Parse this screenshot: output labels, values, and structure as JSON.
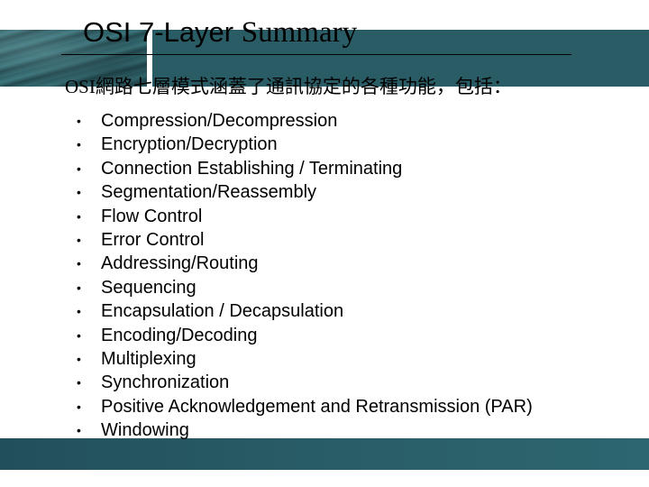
{
  "slide": {
    "title_sans": "OSI 7-Layer",
    "title_serif": "Summary",
    "intro": "OSI網路七層模式涵蓋了通訊協定的各種功能，包括：",
    "bullet_glyph": "•",
    "items": [
      "Compression/Decompression",
      "Encryption/Decryption",
      "Connection Establishing / Terminating",
      "Segmentation/Reassembly",
      "Flow Control",
      "Error Control",
      "Addressing/Routing",
      "Sequencing",
      "Encapsulation / Decapsulation",
      "Encoding/Decoding",
      "Multiplexing",
      "Synchronization",
      "Positive Acknowledgement and Retransmission (PAR)",
      "Windowing"
    ]
  },
  "theme": {
    "band_color": "#2a5c66",
    "text_color": "#000000"
  }
}
